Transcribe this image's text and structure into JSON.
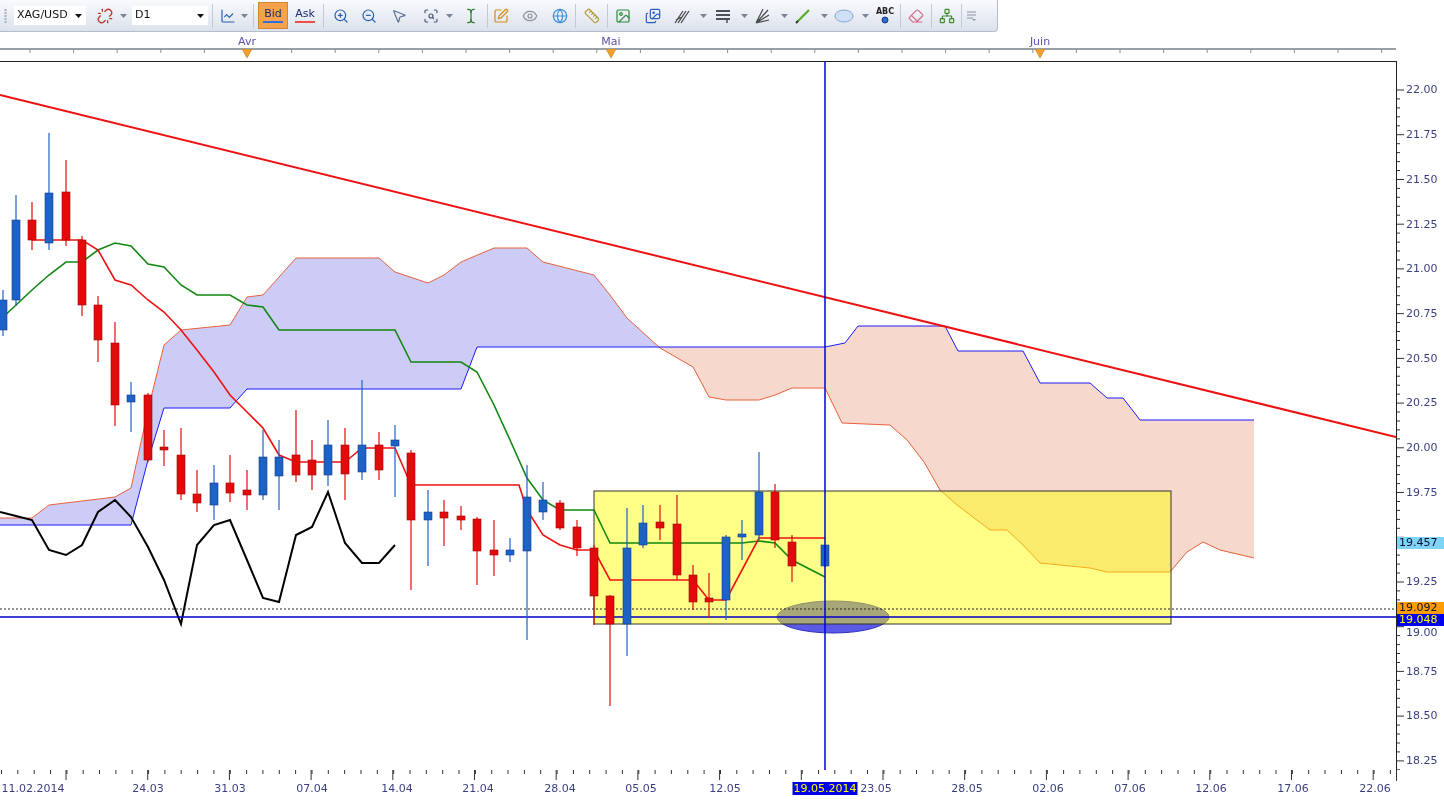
{
  "toolbar": {
    "symbol": "XAG/USD",
    "timeframe": "D1",
    "price_buttons": [
      {
        "label": "Bid",
        "selected": true
      },
      {
        "label": "Ask",
        "selected": false
      }
    ],
    "text_tool": "ABC"
  },
  "chart": {
    "months": [
      "Avr",
      "Mai",
      "Juin"
    ],
    "price_axis": [
      "22.00",
      "21.75",
      "21.50",
      "21.25",
      "21.00",
      "20.75",
      "20.50",
      "20.25",
      "20.00",
      "19.75",
      "19.25",
      "19.00",
      "18.75",
      "18.50",
      "18.25"
    ],
    "price_badges": [
      {
        "text": "19.457",
        "color": "#7fd3f7"
      },
      {
        "text": "19.092",
        "color": "#ff9c00"
      },
      {
        "text": "19.048",
        "color": "#0000f0"
      }
    ],
    "date_axis": [
      {
        "text": "11.02.2014",
        "highlighted": false
      },
      {
        "text": "24.03",
        "highlighted": false
      },
      {
        "text": "31.03",
        "highlighted": false
      },
      {
        "text": "07.04",
        "highlighted": false
      },
      {
        "text": "14.04",
        "highlighted": false
      },
      {
        "text": "21.04",
        "highlighted": false
      },
      {
        "text": "28.04",
        "highlighted": false
      },
      {
        "text": "05.05",
        "highlighted": false
      },
      {
        "text": "12.05",
        "highlighted": false
      },
      {
        "text": "19.05.2014",
        "highlighted": true
      },
      {
        "text": "23.05",
        "highlighted": false
      },
      {
        "text": "28.05",
        "highlighted": false
      },
      {
        "text": "02.06",
        "highlighted": false
      },
      {
        "text": "07.06",
        "highlighted": false
      },
      {
        "text": "12.06",
        "highlighted": false
      },
      {
        "text": "17.06",
        "highlighted": false
      },
      {
        "text": "22.06",
        "highlighted": false
      }
    ]
  }
}
